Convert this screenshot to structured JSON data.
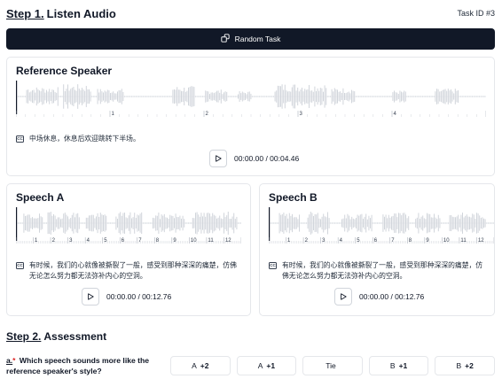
{
  "step1": {
    "prefix": "Step 1.",
    "title": "Listen Audio"
  },
  "task_id": "Task ID #3",
  "random_task_label": "Random Task",
  "reference": {
    "title": "Reference Speaker",
    "ticks": [
      "1",
      "2",
      "3",
      "4"
    ],
    "caption": "中场休息，休息后欢迎跳转下半场。",
    "time": "00:00.00 / 00:04.46"
  },
  "speech_a": {
    "title": "Speech A",
    "ticks": [
      "1",
      "2",
      "3",
      "4",
      "5",
      "6",
      "7",
      "8",
      "9",
      "10",
      "11",
      "12"
    ],
    "caption": "有时候，我们的心就像被撕裂了一般，感受到那种深深的痛楚，仿佛无论怎么努力都无法弥补内心的空洞。",
    "time": "00:00.00 / 00:12.76"
  },
  "speech_b": {
    "title": "Speech B",
    "ticks": [
      "1",
      "2",
      "3",
      "4",
      "5",
      "6",
      "7",
      "8",
      "9",
      "10",
      "11",
      "12"
    ],
    "caption": "有时候，我们的心就像被撕裂了一般，感受到那种深深的痛楚，仿佛无论怎么努力都无法弥补内心的空洞。",
    "time": "00:00.00 / 00:12.76"
  },
  "step2": {
    "prefix": "Step 2.",
    "title": "Assessment"
  },
  "question": {
    "letter": "a.",
    "required_mark": "*",
    "text": "Which speech sounds more like the reference speaker's style?"
  },
  "choices": [
    {
      "name": "A",
      "score": "+2"
    },
    {
      "name": "A",
      "score": "+1"
    },
    {
      "name": "Tie",
      "score": ""
    },
    {
      "name": "B",
      "score": "+1"
    },
    {
      "name": "B",
      "score": "+2"
    }
  ],
  "icons": {
    "random": "shuffle-box-icon",
    "caption": "closed-caption-icon",
    "play": "play-icon"
  },
  "colors": {
    "primary": "#111827",
    "waveform": "#d1d5db",
    "cursor": "#111827",
    "required": "#dc2626"
  }
}
